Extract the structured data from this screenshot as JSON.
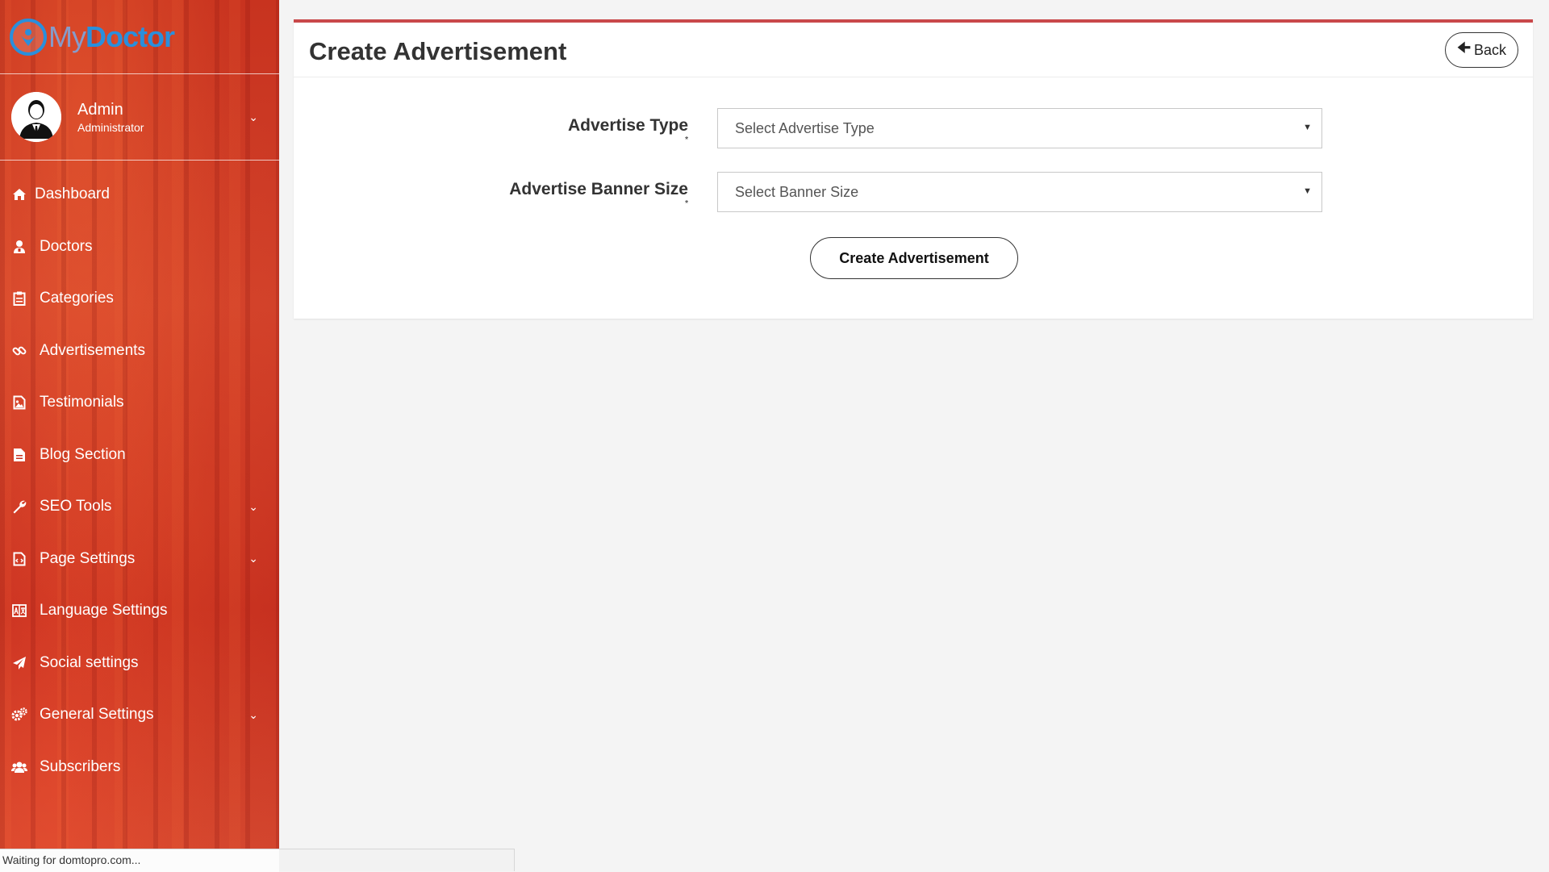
{
  "brand": {
    "logo_my": "My",
    "logo_doctor": "Doctor"
  },
  "user": {
    "name": "Admin",
    "role": "Administrator"
  },
  "sidebar": {
    "items": [
      {
        "label": "Dashboard",
        "icon": "home-icon",
        "has_submenu": false
      },
      {
        "label": "Doctors",
        "icon": "user-md-icon",
        "has_submenu": false
      },
      {
        "label": "Categories",
        "icon": "clipboard-icon",
        "has_submenu": false
      },
      {
        "label": "Advertisements",
        "icon": "link-icon",
        "has_submenu": false
      },
      {
        "label": "Testimonials",
        "icon": "image-icon",
        "has_submenu": false
      },
      {
        "label": "Blog Section",
        "icon": "file-icon",
        "has_submenu": false
      },
      {
        "label": "SEO Tools",
        "icon": "wrench-icon",
        "has_submenu": true
      },
      {
        "label": "Page Settings",
        "icon": "file-code-icon",
        "has_submenu": true
      },
      {
        "label": "Language Settings",
        "icon": "language-icon",
        "has_submenu": false
      },
      {
        "label": "Social settings",
        "icon": "paper-plane-icon",
        "has_submenu": false
      },
      {
        "label": "General Settings",
        "icon": "cogs-icon",
        "has_submenu": true
      },
      {
        "label": "Subscribers",
        "icon": "users-icon",
        "has_submenu": false
      }
    ]
  },
  "main": {
    "title": "Create Advertisement",
    "back_label": "Back",
    "form": {
      "advertise_type": {
        "label": "Advertise Type",
        "required_mark": "*",
        "value": "Select Advertise Type"
      },
      "banner_size": {
        "label": "Advertise Banner Size",
        "required_mark": "*",
        "value": "Select Banner Size"
      },
      "submit_label": "Create Advertisement"
    }
  },
  "status_bar": {
    "text": "Waiting for domtopro.com..."
  },
  "colors": {
    "sidebar_bg": "#c9301f",
    "accent_border": "#c9484a",
    "logo_blue": "#2a8fdc",
    "page_bg": "#f4f4f4"
  }
}
